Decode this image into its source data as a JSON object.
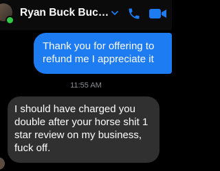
{
  "header": {
    "contact_name": "Ryan Buck Buchan...",
    "accent_color": "#1e7cf2",
    "icons": [
      "chevron-down-icon",
      "phone-icon",
      "video-camera-icon"
    ]
  },
  "messages": [
    {
      "direction": "sent",
      "text": "Thank you for offering to refund me I appreciate it"
    },
    {
      "direction": "received",
      "text": "I should have charged you double after your horse shit 1 star review on my business, fuck off."
    }
  ],
  "timestamp": "11:55 AM"
}
